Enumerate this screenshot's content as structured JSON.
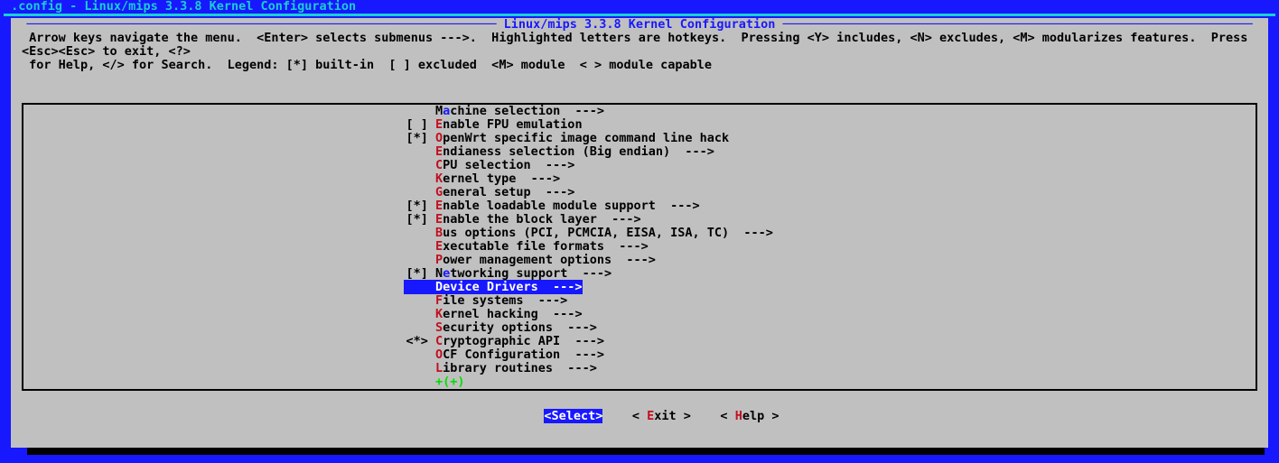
{
  "window_title": ".config - Linux/mips 3.3.8 Kernel Configuration",
  "dialog_title": " Linux/mips 3.3.8 Kernel Configuration ",
  "help_line1": " Arrow keys navigate the menu.  <Enter> selects submenus --->.  Highlighted letters are hotkeys.  Pressing <Y> includes, <N> excludes, <M> modularizes features.  Press <Esc><Esc> to exit, <?>",
  "help_line2": " for Help, </> for Search.  Legend: [*] built-in  [ ] excluded  <M> module  < > module capable",
  "menu": [
    {
      "mark": "   ",
      "pre": "M",
      "hot": "a",
      "post": "chine selection  --->",
      "hotclass": "hotkey-net"
    },
    {
      "mark": "[ ]",
      "pre": "",
      "hot": "E",
      "post": "nable FPU emulation",
      "hotclass": "hotkey"
    },
    {
      "mark": "[*]",
      "pre": "",
      "hot": "O",
      "post": "penWrt specific image command line hack",
      "hotclass": "hotkey"
    },
    {
      "mark": "   ",
      "pre": "",
      "hot": "E",
      "post": "ndianess selection (Big endian)  --->",
      "hotclass": "hotkey"
    },
    {
      "mark": "   ",
      "pre": "",
      "hot": "C",
      "post": "PU selection  --->",
      "hotclass": "hotkey"
    },
    {
      "mark": "   ",
      "pre": "",
      "hot": "K",
      "post": "ernel type  --->",
      "hotclass": "hotkey"
    },
    {
      "mark": "   ",
      "pre": "",
      "hot": "G",
      "post": "eneral setup  --->",
      "hotclass": "hotkey"
    },
    {
      "mark": "[*]",
      "pre": "",
      "hot": "E",
      "post": "nable loadable module support  --->",
      "hotclass": "hotkey"
    },
    {
      "mark": "[*]",
      "pre": "",
      "hot": "E",
      "post": "nable the block layer  --->",
      "hotclass": "hotkey"
    },
    {
      "mark": "   ",
      "pre": "",
      "hot": "B",
      "post": "us options (PCI, PCMCIA, EISA, ISA, TC)  --->",
      "hotclass": "hotkey"
    },
    {
      "mark": "   ",
      "pre": "",
      "hot": "E",
      "post": "xecutable file formats  --->",
      "hotclass": "hotkey"
    },
    {
      "mark": "   ",
      "pre": "",
      "hot": "P",
      "post": "ower management options  --->",
      "hotclass": "hotkey"
    },
    {
      "mark": "[*]",
      "pre": "N",
      "hot": "e",
      "post": "tworking support  --->",
      "hotclass": "hotkey-net"
    }
  ],
  "selected": {
    "mark": "   ",
    "label": "Device Drivers  --->"
  },
  "menu_after": [
    {
      "mark": "   ",
      "pre": "",
      "hot": "F",
      "post": "ile systems  --->",
      "hotclass": "hotkey"
    },
    {
      "mark": "   ",
      "pre": "",
      "hot": "K",
      "post": "ernel hacking  --->",
      "hotclass": "hotkey"
    },
    {
      "mark": "   ",
      "pre": "",
      "hot": "S",
      "post": "ecurity options  --->",
      "hotclass": "hotkey"
    },
    {
      "mark": "<*>",
      "pre": "",
      "hot": "C",
      "post": "ryptographic API  --->",
      "hotclass": "hotkey"
    },
    {
      "mark": "   ",
      "pre": "",
      "hot": "O",
      "post": "CF Configuration  --->",
      "hotclass": "hotkey"
    },
    {
      "mark": "   ",
      "pre": "",
      "hot": "L",
      "post": "ibrary routines  --->",
      "hotclass": "hotkey"
    }
  ],
  "scroll_hint": "+(+)",
  "buttons": {
    "select": "<Select>",
    "exit_pre": "< ",
    "exit_hot": "E",
    "exit_post": "xit >",
    "help_pre": "< ",
    "help_hot": "H",
    "help_post": "elp >"
  }
}
